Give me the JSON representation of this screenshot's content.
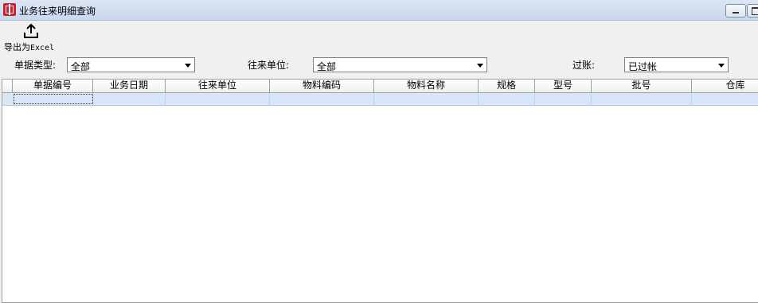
{
  "window": {
    "title": "业务往来明细查询"
  },
  "toolbar": {
    "export_label_prefix": "导出为",
    "export_label_suffix": "Excel",
    "export_icon": "upload-icon"
  },
  "filters": {
    "doc_type": {
      "label": "单据类型:",
      "value": "全部"
    },
    "partner": {
      "label": "往来单位:",
      "value": "全部"
    },
    "posting": {
      "label": "过账:",
      "value": "已过帐"
    }
  },
  "table": {
    "columns": [
      "单据编号",
      "业务日期",
      "往来单位",
      "物料编码",
      "物料名称",
      "规格",
      "型号",
      "批号",
      "仓库"
    ]
  }
}
